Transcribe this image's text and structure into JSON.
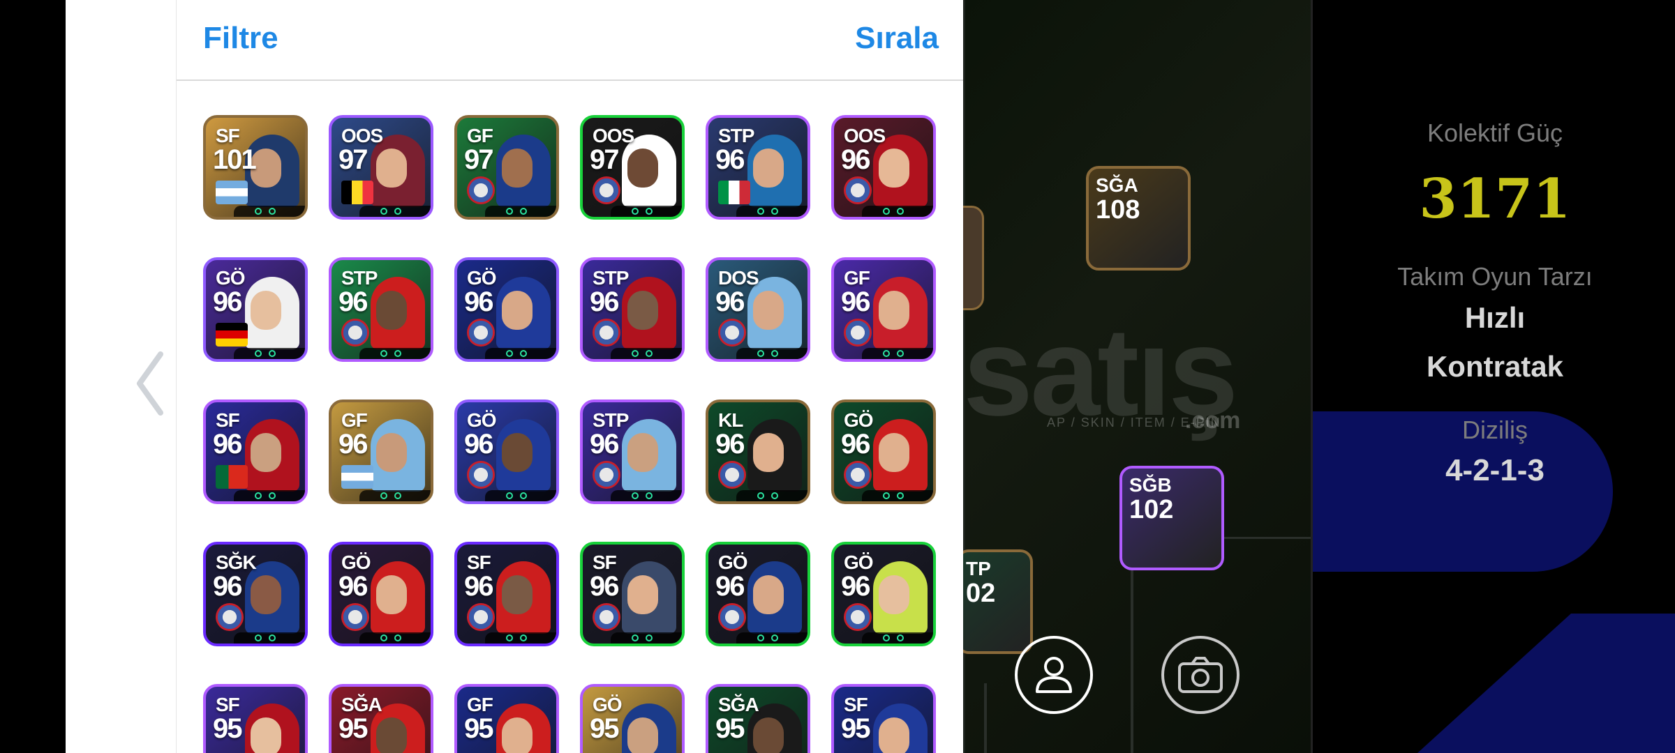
{
  "header": {
    "filter_label": "Filtre",
    "sort_label": "Sırala"
  },
  "cards": [
    {
      "pos": "SF",
      "rating": "101",
      "border": "#8a6a3a",
      "bg": "#cf9a40",
      "skin": "#c89a7a",
      "shirt": "#1f3a6b",
      "badge": "flag-argentina"
    },
    {
      "pos": "OOS",
      "rating": "97",
      "border": "#9b59ff",
      "bg": "#2e4a8a",
      "skin": "#e0b08e",
      "shirt": "#7a2030",
      "badge": "flag-belgium"
    },
    {
      "pos": "GF",
      "rating": "97",
      "border": "#8a6a3a",
      "bg": "#1c7a3a",
      "skin": "#a06f4e",
      "shirt": "#1b3b8a",
      "badge": "club-crest"
    },
    {
      "pos": "OOS",
      "rating": "97",
      "border": "#18d13a",
      "bg": "#1a1a1a",
      "skin": "#6e4a35",
      "shirt": "#ffffff",
      "badge": "club-crest"
    },
    {
      "pos": "STP",
      "rating": "96",
      "border": "#b05bff",
      "bg": "#2a3a70",
      "skin": "#d8a888",
      "shirt": "#1f6fb0",
      "badge": "flag-italy"
    },
    {
      "pos": "OOS",
      "rating": "96",
      "border": "#b05bff",
      "bg": "#5a1a2a",
      "skin": "#e6b896",
      "shirt": "#b0121e",
      "badge": "club-crest"
    },
    {
      "pos": "GÖ",
      "rating": "96",
      "border": "#8f5bff",
      "bg": "#4a2a9a",
      "skin": "#e6bf9e",
      "shirt": "#f0f0f0",
      "badge": "flag-germany"
    },
    {
      "pos": "STP",
      "rating": "96",
      "border": "#b05bff",
      "bg": "#1a8a4a",
      "skin": "#6a4a35",
      "shirt": "#cc1e1e",
      "badge": "club-crest"
    },
    {
      "pos": "GÖ",
      "rating": "96",
      "border": "#8f5bff",
      "bg": "#1a2a8a",
      "skin": "#d8a888",
      "shirt": "#1f3a9a",
      "badge": "club-crest"
    },
    {
      "pos": "STP",
      "rating": "96",
      "border": "#b05bff",
      "bg": "#3a2a9a",
      "skin": "#7a5a45",
      "shirt": "#b0121e",
      "badge": "club-crest"
    },
    {
      "pos": "DOS",
      "rating": "96",
      "border": "#b05bff",
      "bg": "#2a5a7a",
      "skin": "#d8a888",
      "shirt": "#7ab4e0",
      "badge": "club-crest"
    },
    {
      "pos": "GF",
      "rating": "96",
      "border": "#b05bff",
      "bg": "#4a2aa8",
      "skin": "#e0b08e",
      "shirt": "#c81e2a",
      "badge": "club-crest"
    },
    {
      "pos": "SF",
      "rating": "96",
      "border": "#b05bff",
      "bg": "#2a2a9a",
      "skin": "#caa080",
      "shirt": "#b0121e",
      "badge": "flag-portugal"
    },
    {
      "pos": "GF",
      "rating": "96",
      "border": "#8a6a3a",
      "bg": "#c49a40",
      "skin": "#c89a7a",
      "shirt": "#7ab4e0",
      "badge": "flag-argentina"
    },
    {
      "pos": "GÖ",
      "rating": "96",
      "border": "#8f5bff",
      "bg": "#2a3aa8",
      "skin": "#6a4a35",
      "shirt": "#1f3a9a",
      "badge": "club-crest"
    },
    {
      "pos": "STP",
      "rating": "96",
      "border": "#b05bff",
      "bg": "#3a2a9a",
      "skin": "#caa080",
      "shirt": "#7ab4e0",
      "badge": "club-crest"
    },
    {
      "pos": "KL",
      "rating": "96",
      "border": "#8a6a3a",
      "bg": "#0e4a2a",
      "skin": "#e0b08e",
      "shirt": "#1a1a1a",
      "badge": "club-crest"
    },
    {
      "pos": "GÖ",
      "rating": "96",
      "border": "#8a6a3a",
      "bg": "#0e4a2a",
      "skin": "#e0b08e",
      "shirt": "#cc1e1e",
      "badge": "club-crest"
    },
    {
      "pos": "SĞK",
      "rating": "96",
      "border": "#6a2aff",
      "bg": "#1a1a3a",
      "skin": "#8a5a45",
      "shirt": "#1b3b8a",
      "badge": "club-crest"
    },
    {
      "pos": "GÖ",
      "rating": "96",
      "border": "#6a2aff",
      "bg": "#2a1a3a",
      "skin": "#e0b08e",
      "shirt": "#cc1e1e",
      "badge": "club-crest"
    },
    {
      "pos": "SF",
      "rating": "96",
      "border": "#6a2aff",
      "bg": "#1a1a3a",
      "skin": "#7a5a45",
      "shirt": "#cc1e1e",
      "badge": "club-crest"
    },
    {
      "pos": "SF",
      "rating": "96",
      "border": "#18d13a",
      "bg": "#1a1a2a",
      "skin": "#e0b08e",
      "shirt": "#3a4a6a",
      "badge": "club-crest"
    },
    {
      "pos": "GÖ",
      "rating": "96",
      "border": "#18d13a",
      "bg": "#1a1a2a",
      "skin": "#d8a888",
      "shirt": "#1b3b8a",
      "badge": "club-crest"
    },
    {
      "pos": "GÖ",
      "rating": "96",
      "border": "#18d13a",
      "bg": "#1a1a2a",
      "skin": "#e6bf9e",
      "shirt": "#c8e04a",
      "badge": "club-crest"
    },
    {
      "pos": "SF",
      "rating": "95",
      "border": "#b05bff",
      "bg": "#3a2a9a",
      "skin": "#e6bf9e",
      "shirt": "#b0121e",
      "badge": ""
    },
    {
      "pos": "SĞA",
      "rating": "95",
      "border": "#b05bff",
      "bg": "#8a1a2a",
      "skin": "#6a4a35",
      "shirt": "#cc1e1e",
      "badge": ""
    },
    {
      "pos": "GF",
      "rating": "95",
      "border": "#b05bff",
      "bg": "#1a2a8a",
      "skin": "#e0b08e",
      "shirt": "#cc1e1e",
      "badge": ""
    },
    {
      "pos": "GÖ",
      "rating": "95",
      "border": "#b05bff",
      "bg": "#c49a40",
      "skin": "#caa080",
      "shirt": "#1b3b8a",
      "badge": ""
    },
    {
      "pos": "SĞA",
      "rating": "95",
      "border": "#b05bff",
      "bg": "#0e4a2a",
      "skin": "#6a4a35",
      "shirt": "#1a1a1a",
      "badge": ""
    },
    {
      "pos": "SF",
      "rating": "95",
      "border": "#b05bff",
      "bg": "#1a2a8a",
      "skin": "#e0b08e",
      "shirt": "#1f3a9a",
      "badge": ""
    }
  ],
  "field": {
    "watermark": "satış",
    "watermark_sub": "AP / SKIN / ITEM / E-PIN",
    "watermark_com": ".com",
    "cards": [
      {
        "pos": "SĞA",
        "rating": "108",
        "border": "#8a6a3a",
        "bg": "#4a3a1a"
      },
      {
        "pos": "SĞB",
        "rating": "102",
        "border": "#b05bff",
        "bg": "#3a2a6a"
      },
      {
        "pos": "TP",
        "rating": "02",
        "border": "#8a6a3a",
        "bg": "#1a3a2a"
      }
    ]
  },
  "right_panel": {
    "collective_label": "Kolektif Güç",
    "collective_value": "3171",
    "play_style_label": "Takım Oyun Tarzı",
    "play_style_line1": "Hızlı",
    "play_style_line2": "Kontratak",
    "formation_label": "Diziliş",
    "formation_value": "4-2-1-3"
  },
  "colors": {
    "accent_blue": "#1e88e5",
    "gold": "#c8c41a"
  }
}
